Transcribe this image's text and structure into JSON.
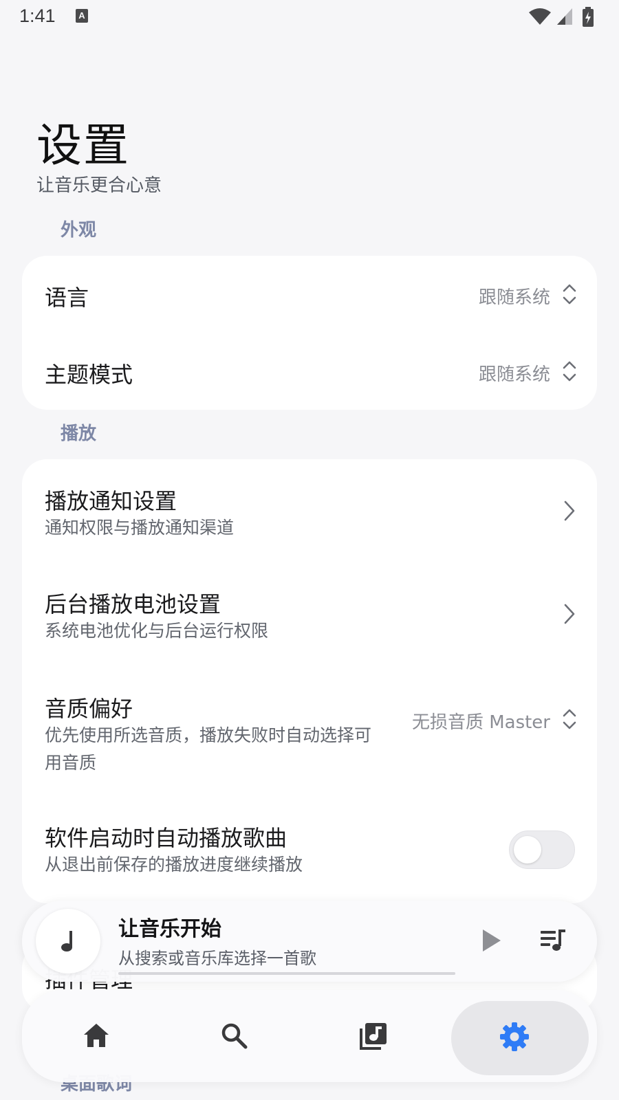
{
  "status_bar": {
    "time": "1:41",
    "notification_icon": "a-icon"
  },
  "header": {
    "title": "设置",
    "subtitle": "让音乐更合心意"
  },
  "sections": {
    "appearance": {
      "label": "外观",
      "rows": {
        "language": {
          "title": "语言",
          "value": "跟随系统"
        },
        "theme": {
          "title": "主题模式",
          "value": "跟随系统"
        }
      }
    },
    "playback": {
      "label": "播放",
      "rows": {
        "notification": {
          "title": "播放通知设置",
          "subtitle": "通知权限与播放通知渠道"
        },
        "battery": {
          "title": "后台播放电池设置",
          "subtitle": "系统电池优化与后台运行权限"
        },
        "quality": {
          "title": "音质偏好",
          "subtitle": "优先使用所选音质，播放失败时自动选择可用音质",
          "value": "无损音质 Master"
        },
        "autoplay": {
          "title": "软件启动时自动播放歌曲",
          "subtitle": "从退出前保存的播放进度继续播放",
          "enabled": false
        }
      }
    },
    "partially_hidden": {
      "plugins_title": "插件管理",
      "next_section_label": "桌面歌词"
    }
  },
  "player": {
    "title": "让音乐开始",
    "subtitle": "从搜索或音乐库选择一首歌",
    "progress": 0.0
  },
  "nav": {
    "active": "settings",
    "items": [
      "home",
      "search",
      "library",
      "settings"
    ]
  },
  "colors": {
    "accent": "#2f7cf6",
    "section_label": "#7d87a6",
    "background": "#f6f6f8"
  }
}
